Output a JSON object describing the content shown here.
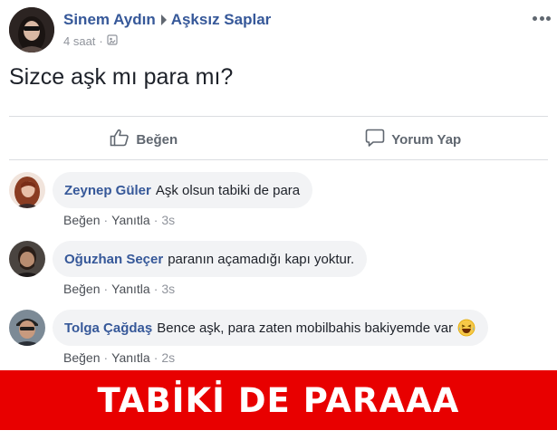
{
  "post": {
    "author": "Sinem Aydın",
    "group": "Aşksız Saplar",
    "time": "4 saat",
    "separator": "·",
    "text": "Sizce aşk mı para mı?"
  },
  "actions": {
    "like_label": "Beğen",
    "comment_label": "Yorum Yap"
  },
  "comments": [
    {
      "name": "Zeynep Güler",
      "text": "Aşk olsun tabiki de para",
      "like": "Beğen",
      "reply": "Yanıtla",
      "sep": "·",
      "time": "3s"
    },
    {
      "name": "Oğuzhan Seçer",
      "text": "paranın açamadığı kapı yoktur.",
      "like": "Beğen",
      "reply": "Yanıtla",
      "sep": "·",
      "time": "3s"
    },
    {
      "name": "Tolga Çağdaş",
      "text": "Bence aşk, para zaten mobilbahis bakiyemde var",
      "like": "Beğen",
      "reply": "Yanıtla",
      "sep": "·",
      "time": "2s"
    }
  ],
  "banner": {
    "text": "TABİKİ DE PARAAA",
    "color": "#e80000"
  },
  "colors": {
    "link": "#365899",
    "muted": "#90949c",
    "bubble": "#f2f3f5"
  },
  "icons": [
    "more-icon",
    "globe-icon",
    "like-icon",
    "comment-icon",
    "laughing-emoji-icon"
  ]
}
